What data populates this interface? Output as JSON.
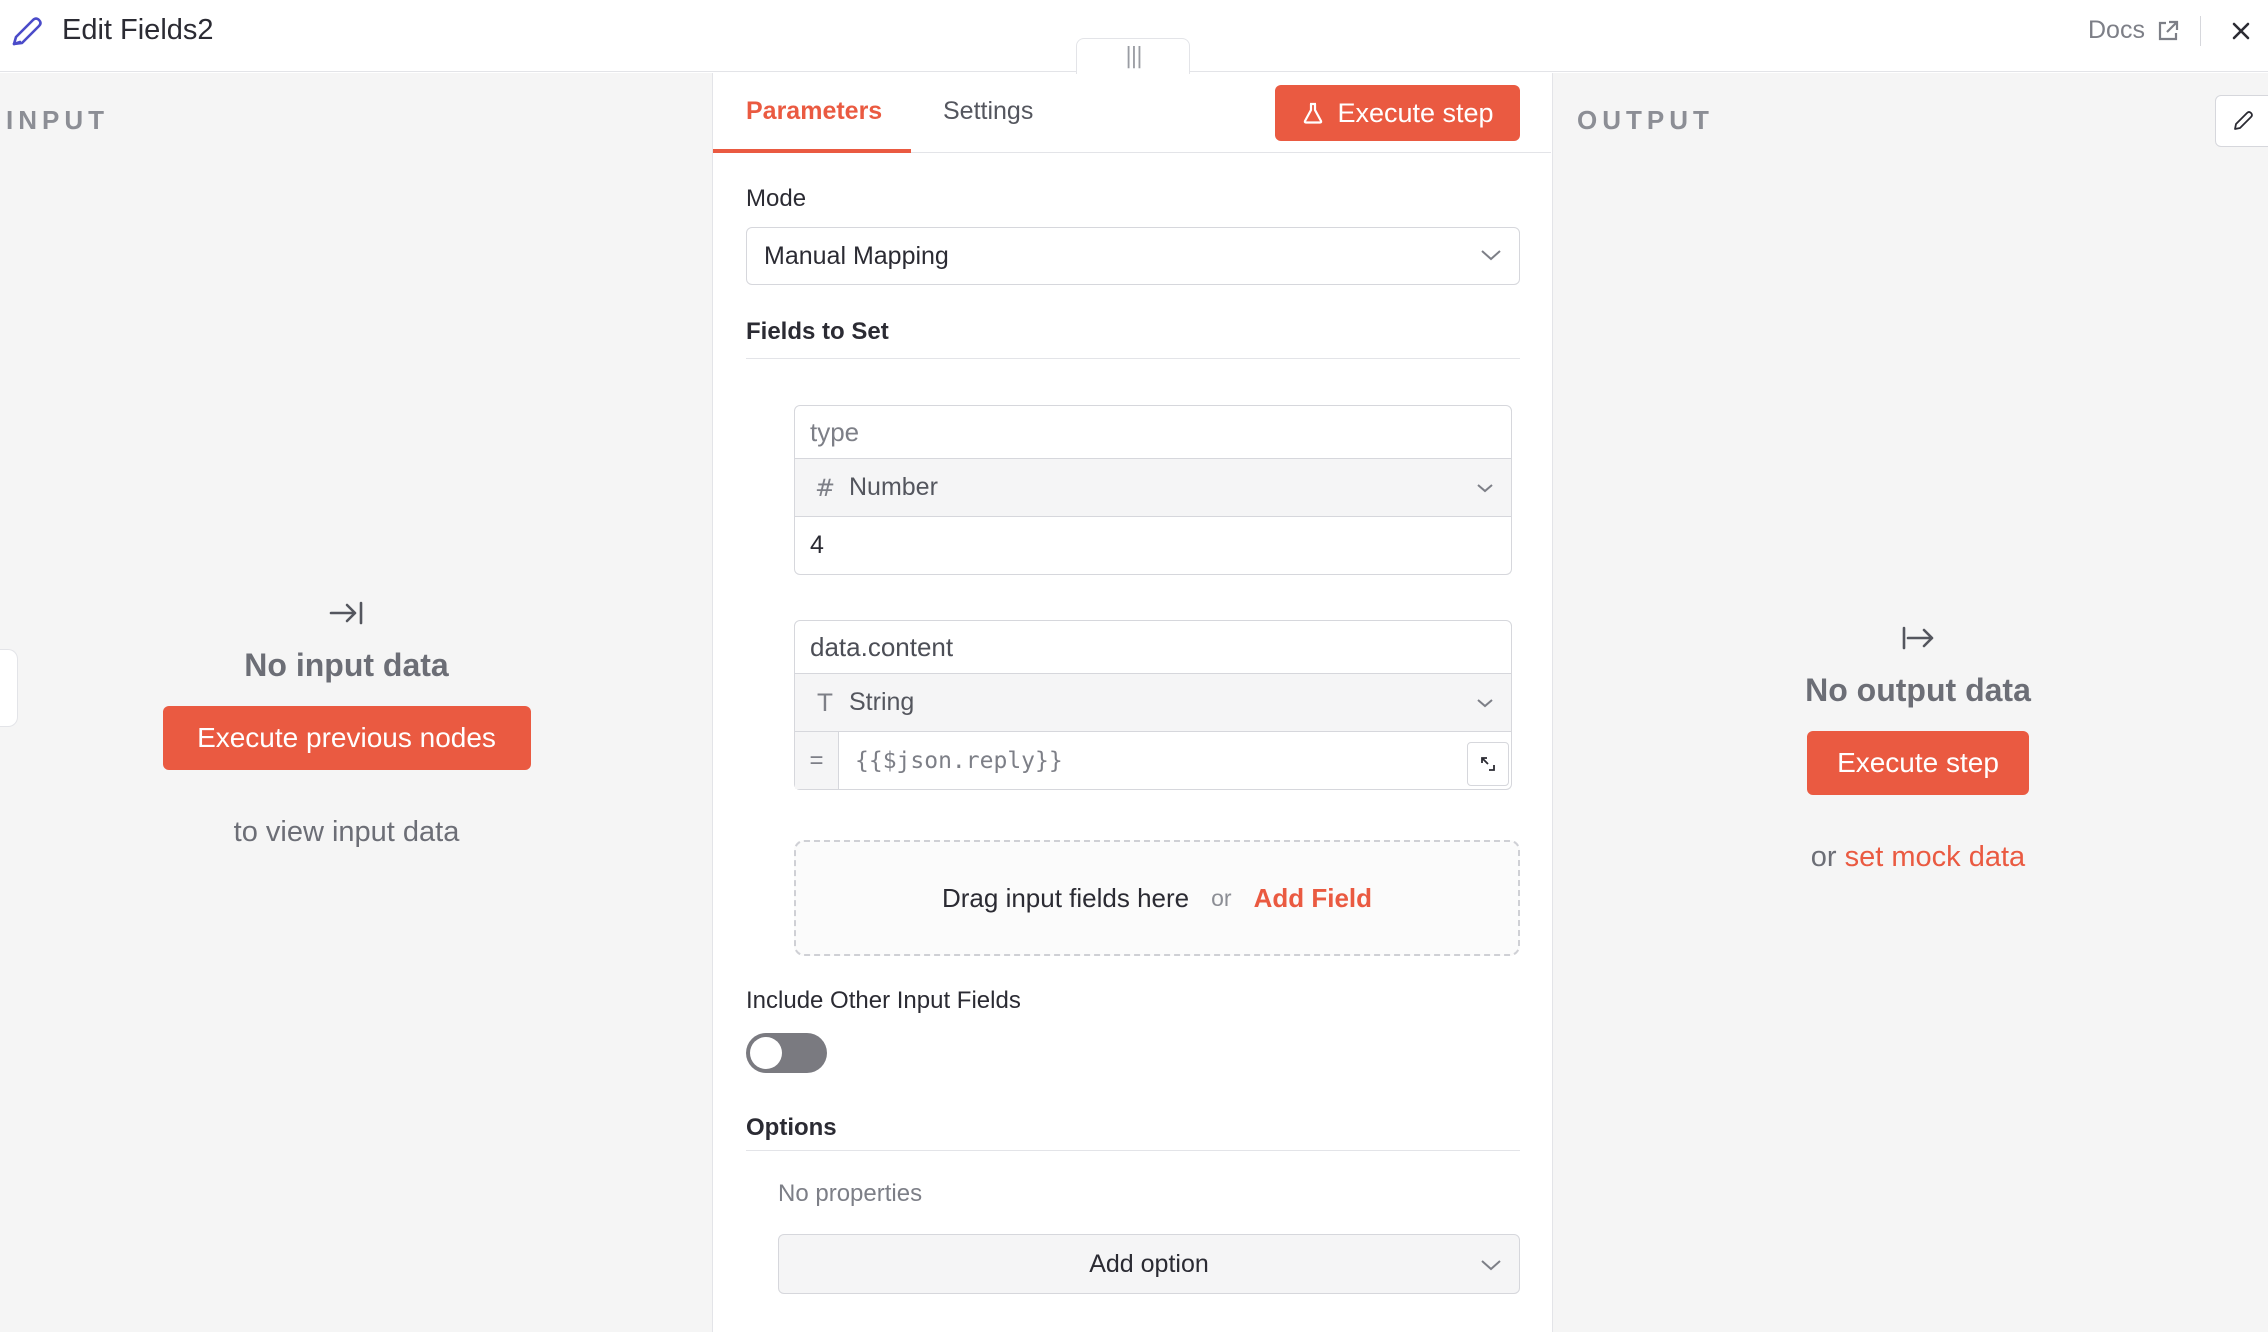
{
  "header": {
    "title": "Edit Fields2",
    "docs_label": "Docs"
  },
  "input_panel": {
    "label": "INPUT",
    "empty_title": "No input data",
    "execute_button": "Execute previous nodes",
    "hint": "to view input data"
  },
  "tabs": {
    "parameters": "Parameters",
    "settings": "Settings",
    "execute_button": "Execute step"
  },
  "parameters": {
    "mode_label": "Mode",
    "mode_value": "Manual Mapping",
    "fields_label": "Fields to Set",
    "fields": [
      {
        "name": "type",
        "type_icon": "#",
        "type_label": "Number",
        "value": "4"
      },
      {
        "name": "data.content",
        "type_icon": "T",
        "type_label": "String",
        "expr_prefix": "=",
        "value": "{{$json.reply}}"
      }
    ],
    "drop_text": "Drag input fields here",
    "drop_or": "or",
    "add_field": "Add Field",
    "include_label": "Include Other Input Fields",
    "include_enabled": false,
    "options_label": "Options",
    "no_properties": "No properties",
    "add_option": "Add option"
  },
  "output_panel": {
    "label": "OUTPUT",
    "empty_title": "No output data",
    "execute_button": "Execute step",
    "hint_prefix": "or",
    "mock_link": "set mock data"
  },
  "colors": {
    "accent": "#ea5a41",
    "panel_bg": "#f5f5f5"
  }
}
